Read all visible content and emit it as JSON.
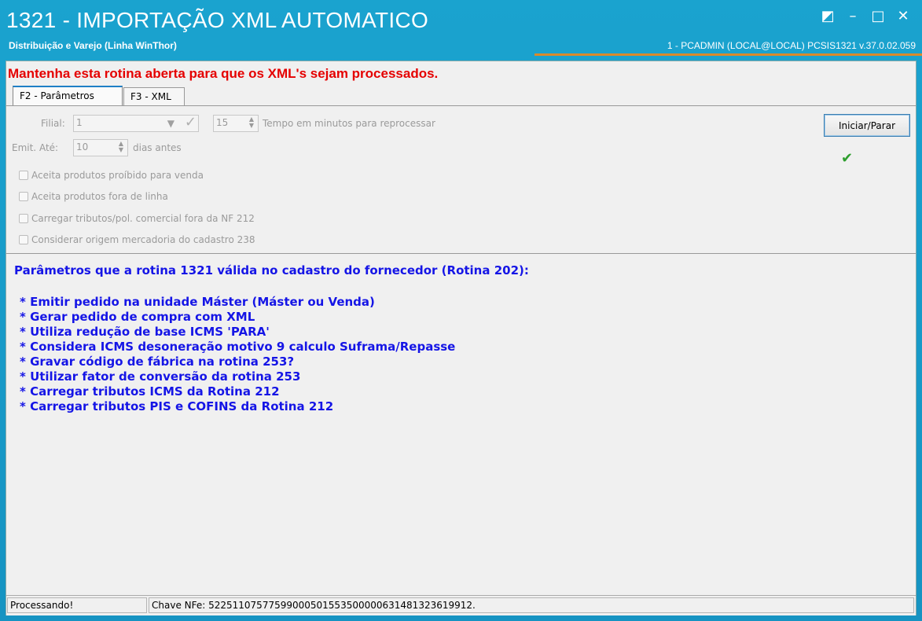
{
  "window": {
    "title": "1321 - IMPORTAÇÃO XML AUTOMATICO",
    "subtitle": "Distribuição e Varejo (Linha WinThor)",
    "userinfo": "1 - PCADMIN (LOCAL@LOCAL)   PCSIS1321  v.37.0.02.059",
    "controls": {
      "restore": "◩",
      "minimize": "–",
      "maximize": "□",
      "close": "✕"
    }
  },
  "warning": "Mantenha esta rotina aberta para que os XML's sejam processados.",
  "tabs": [
    {
      "label": "F2 - Parâmetros",
      "active": true
    },
    {
      "label": "F3 - XML",
      "active": false
    }
  ],
  "params": {
    "filial_label": "Filial:",
    "filial_value": "1",
    "tempo_value": "15",
    "tempo_label": "Tempo em minutos para reprocessar",
    "emit_label": "Emit. Até:",
    "emit_value": "10",
    "emit_suffix": "dias antes",
    "checkboxes": [
      "Aceita produtos proíbido para venda",
      "Aceita produtos fora de linha",
      "Carregar tributos/pol. comercial fora da NF 212",
      "Considerar origem mercadoria do cadastro 238"
    ]
  },
  "start_button": "Iniciar/Parar",
  "info": {
    "title": "Parâmetros que a rotina 1321 válida no cadastro do fornecedor (Rotina 202):",
    "items": [
      "* Emitir pedido na unidade Máster (Máster ou Venda)",
      "* Gerar pedido de compra com XML",
      "* Utiliza redução de base ICMS 'PARA'",
      "* Considera ICMS desoneração motivo 9 calculo Suframa/Repasse",
      "* Gravar código de fábrica na rotina 253?",
      "* Utilizar fator de conversão da rotina 253",
      "* Carregar tributos ICMS da Rotina 212",
      "* Carregar tributos PIS e COFINS da Rotina 212"
    ]
  },
  "statusbar": {
    "status": "Processando!",
    "chave": "Chave NFe: 52251107577599000501553500000631481323619912."
  },
  "colors": {
    "titlebar": "#1aa3cf",
    "warning": "#e50000",
    "info_text": "#1515e6",
    "accent_line": "#d98a2b",
    "status_check": "#2e9e2e"
  },
  "icons": {
    "filial_confirm": "check-icon",
    "status": "green-check-icon"
  }
}
